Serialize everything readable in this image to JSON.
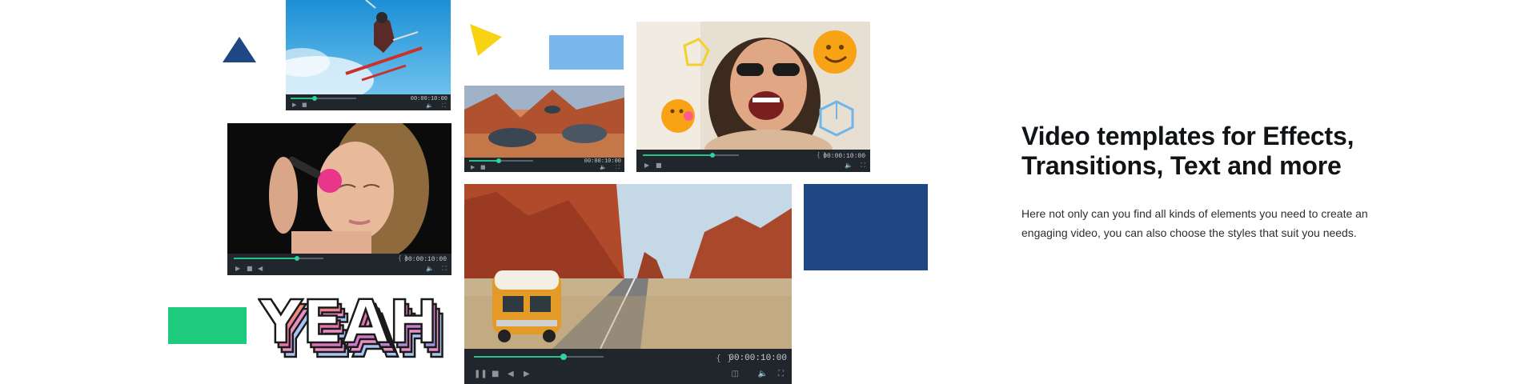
{
  "section": {
    "heading": "Video templates for Effects, Transitions, Text and more",
    "description": "Here not only can you find all kinds of elements you need to create an engaging video, you can also choose the styles that suit you needs."
  },
  "decor_text": "YEAH",
  "players": [
    {
      "id": "ski",
      "timecode": "00:00:10:00",
      "progress": 0.35
    },
    {
      "id": "racing",
      "timecode": "00:00:10:00",
      "progress": 0.45
    },
    {
      "id": "emoji",
      "timecode": "00:00:10:00",
      "progress": 0.72
    },
    {
      "id": "makeup",
      "timecode": "00:00:10:00",
      "progress": 0.7
    },
    {
      "id": "van",
      "timecode": "00:00:10:00",
      "progress": 0.68
    }
  ],
  "colors": {
    "navy": "#1e4784",
    "sky": "#7ab8ec",
    "yellow": "#f7d313",
    "green": "#1ecb7e",
    "accent": "#23c48a"
  }
}
